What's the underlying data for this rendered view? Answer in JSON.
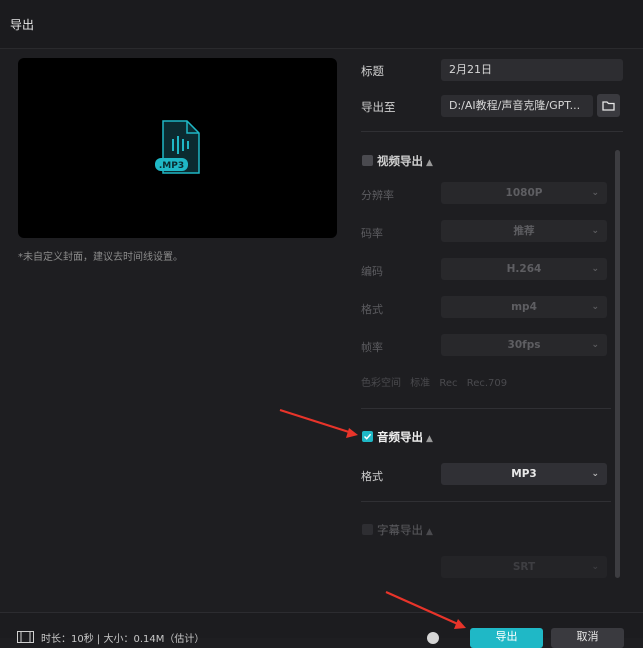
{
  "dialog": {
    "title": "导出"
  },
  "preview": {
    "file_badge": ".MP3",
    "cover_note": "*未自定义封面，建议去时间线设置。"
  },
  "export": {
    "title_label": "标题",
    "title_value": "2月21日",
    "path_label": "导出至",
    "path_value": "D:/AI教程/声音克隆/GPT..."
  },
  "video_section": {
    "label": "视频导出",
    "checked": false,
    "rows": [
      {
        "label": "分辨率",
        "value": "1080P"
      },
      {
        "label": "码率",
        "value": "推荐"
      },
      {
        "label": "编码",
        "value": "H.264"
      },
      {
        "label": "格式",
        "value": "mp4"
      },
      {
        "label": "帧率",
        "value": "30fps"
      }
    ],
    "hints": [
      "色彩空间",
      "标准 Rec",
      "Rec.709"
    ]
  },
  "audio_section": {
    "label": "音频导出",
    "checked": true,
    "format_label": "格式",
    "format_value": "MP3"
  },
  "subtitle_section": {
    "label": "字幕导出",
    "checked": false,
    "format_value": "SRT"
  },
  "footer": {
    "duration_text": "时长：10秒 | 大小：0.14M（估计）",
    "export_label": "导出",
    "cancel_label": "取消"
  },
  "colors": {
    "accent": "#1fb8c6",
    "annotation_arrow": "#e8342a"
  }
}
